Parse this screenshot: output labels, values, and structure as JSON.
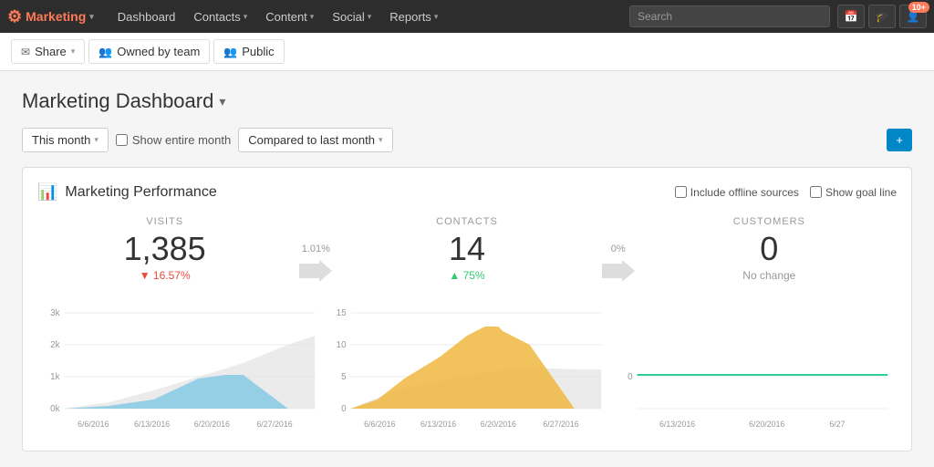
{
  "nav": {
    "brand": "Marketing",
    "items": [
      {
        "label": "Dashboard",
        "active": true
      },
      {
        "label": "Contacts",
        "has_dropdown": true
      },
      {
        "label": "Content",
        "has_dropdown": true
      },
      {
        "label": "Social",
        "has_dropdown": true
      },
      {
        "label": "Reports",
        "has_dropdown": true
      }
    ],
    "search_placeholder": "Search",
    "icons": [
      {
        "name": "calendar",
        "symbol": "31",
        "badge": null
      },
      {
        "name": "graduation",
        "symbol": "🎓",
        "badge": null
      },
      {
        "name": "notifications",
        "symbol": "👤",
        "badge": "10+"
      }
    ]
  },
  "subnav": {
    "share_label": "Share",
    "owned_by_team_label": "Owned by team",
    "public_label": "Public"
  },
  "page": {
    "title": "Marketing Dashboard",
    "title_arrow": "▾"
  },
  "filters": {
    "this_month": "This month",
    "show_entire_month": "Show entire month",
    "compared_to": "Compared to last month",
    "add_btn": "+"
  },
  "card": {
    "title": "Marketing Performance",
    "include_offline": "Include offline sources",
    "show_goal_line": "Show goal line"
  },
  "metrics": {
    "visits": {
      "label": "VISITS",
      "value": "1,385",
      "change": "▼ 16.57%",
      "direction": "down"
    },
    "conversion1": {
      "pct": "1.01%"
    },
    "contacts": {
      "label": "CONTACTS",
      "value": "14",
      "change": "▲ 75%",
      "direction": "up"
    },
    "conversion2": {
      "pct": "0%"
    },
    "customers": {
      "label": "CUSTOMERS",
      "value": "0",
      "change": "No change",
      "direction": "neutral"
    }
  },
  "chart": {
    "visits": {
      "y_labels": [
        "3k",
        "2k",
        "1k",
        "0k"
      ],
      "x_labels": [
        "6/6/2016",
        "6/13/2016",
        "6/20/2016",
        "6/27/2016"
      ]
    },
    "contacts": {
      "y_labels": [
        "15",
        "10",
        "5",
        "0"
      ],
      "x_labels": [
        "6/6/2016",
        "6/13/2016",
        "6/20/2016",
        "6/27/2016"
      ]
    },
    "customers": {
      "y_labels": [
        ""
      ],
      "x_labels": [
        "6/13/2016",
        "6/20/2016",
        "6/27"
      ]
    }
  }
}
